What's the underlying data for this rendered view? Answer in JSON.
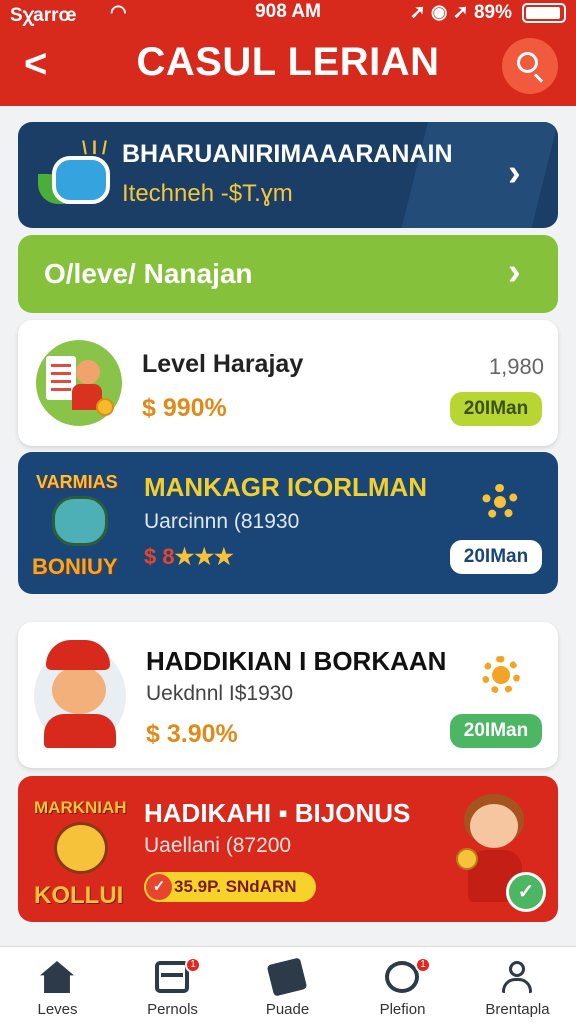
{
  "status_bar": {
    "carrier": "Sꭓarrœ",
    "time": "908 AM",
    "battery": "89%"
  },
  "header": {
    "back_glyph": "<",
    "title": "CASUL LERIAN"
  },
  "promo": {
    "title": "BHARUANIRIMAAARANAIN",
    "subtitle": "Itechneh -$T.ɣm"
  },
  "manage": {
    "label": "O/leve/ Nanajan"
  },
  "levels": [
    {
      "name": "Level Harajay",
      "percent": "$ 990%",
      "count": "1,980",
      "button": "20IMan",
      "button_color": "#b9d531"
    },
    {
      "badge_top": "VARMIAS",
      "badge_bottom": "BONIUY",
      "name": "MANKAGR ICORLMAN",
      "subtitle": "Uarcinnn (81930",
      "rate_prefix": "$ 8",
      "stars": "★★★",
      "button": "20IMan",
      "button_color": "#ffffff"
    },
    {
      "name": "HADDIKIAN I BORKAAN",
      "subtitle": "Uekdnnl I$1930",
      "percent": "$ 3.90%",
      "button": "20IMan",
      "button_color": "#4cb663"
    },
    {
      "badge_top": "MARKNIAH",
      "badge_bottom": "KOLLUI",
      "name": "HADIKAHI ▪ BIJONUS",
      "subtitle": "Uaellani (87200",
      "tag": "35.9P. SNdARN"
    }
  ],
  "tabs": [
    {
      "label": "Leves",
      "icon": "home-icon",
      "badge": ""
    },
    {
      "label": "Pernols",
      "icon": "card-icon",
      "badge": "1"
    },
    {
      "label": "Puade",
      "icon": "gift-icon",
      "badge": ""
    },
    {
      "label": "Plefion",
      "icon": "location-icon",
      "badge": "1"
    },
    {
      "label": "Brentapla",
      "icon": "profile-icon",
      "badge": ""
    }
  ],
  "colors": {
    "brand_red": "#d8291d",
    "navy": "#1a3e66",
    "lime": "#86c13c",
    "gold": "#f6c23a"
  }
}
